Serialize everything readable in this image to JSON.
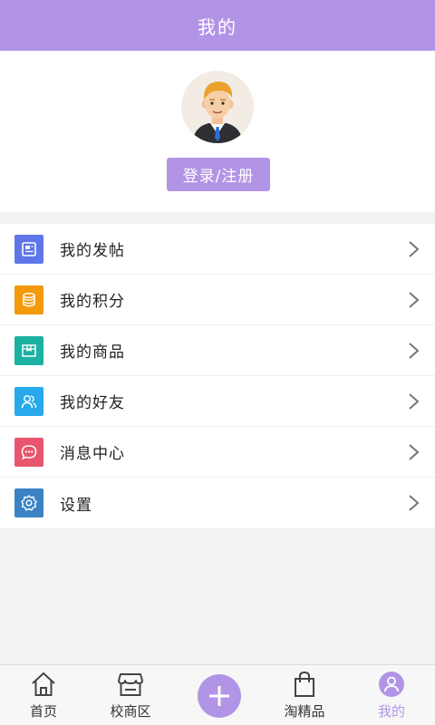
{
  "header": {
    "title": "我的"
  },
  "profile": {
    "avatar_icon": "user-avatar-man",
    "login_label": "登录/注册"
  },
  "menu": {
    "items": [
      {
        "label": "我的发帖",
        "icon": "post-icon",
        "color": "#5f76e8"
      },
      {
        "label": "我的积分",
        "icon": "points-icon",
        "color": "#f39a0a"
      },
      {
        "label": "我的商品",
        "icon": "goods-icon",
        "color": "#1bb2a2"
      },
      {
        "label": "我的好友",
        "icon": "friends-icon",
        "color": "#27a9ec"
      },
      {
        "label": "消息中心",
        "icon": "message-icon",
        "color": "#e8556e"
      },
      {
        "label": "设置",
        "icon": "gear-icon",
        "color": "#3b82c4"
      }
    ]
  },
  "tabbar": {
    "items": [
      {
        "label": "首页",
        "icon": "home-icon"
      },
      {
        "label": "校商区",
        "icon": "store-icon"
      },
      {
        "label": "",
        "icon": "plus-icon"
      },
      {
        "label": "淘精品",
        "icon": "bag-icon"
      },
      {
        "label": "我的",
        "icon": "user-icon",
        "active": true
      }
    ]
  },
  "colors": {
    "accent": "#b294e6"
  }
}
